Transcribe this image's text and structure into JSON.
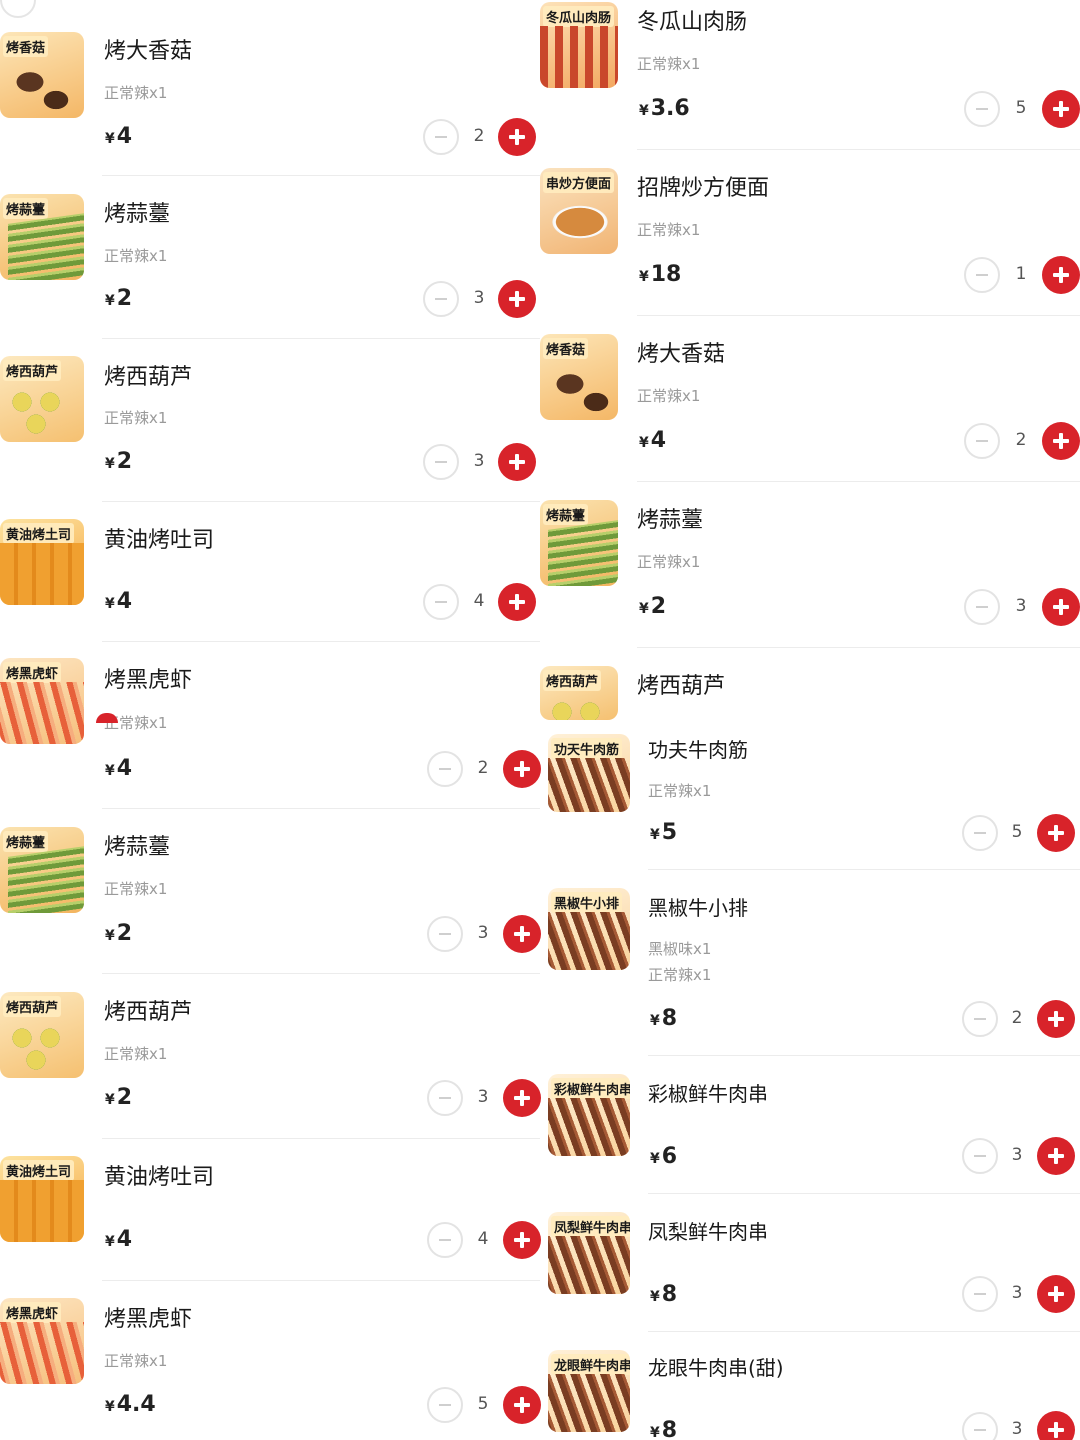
{
  "cart": {
    "left": [
      {
        "name": "烤大香菇",
        "spec": "正常辣x1",
        "price": "4",
        "qty": "2",
        "label": "烤香菇",
        "img": "mushroom"
      },
      {
        "name": "烤蒜薹",
        "spec": "正常辣x1",
        "price": "2",
        "qty": "3",
        "label": "烤蒜薹",
        "img": "garlic"
      },
      {
        "name": "烤西葫芦",
        "spec": "正常辣x1",
        "price": "2",
        "qty": "3",
        "label": "烤西葫芦",
        "img": "zucchini"
      },
      {
        "name": "黄油烤吐司",
        "spec": "",
        "price": "4",
        "qty": "4",
        "label": "黄油烤土司",
        "img": "toast"
      },
      {
        "name": "烤黑虎虾",
        "spec": "正常辣x1",
        "price": "4",
        "qty": "2",
        "label": "烤黑虎虾",
        "img": "shrimp"
      },
      {
        "name": "烤蒜薹",
        "spec": "正常辣x1",
        "price": "2",
        "qty": "3",
        "label": "烤蒜薹",
        "img": "garlic"
      },
      {
        "name": "烤西葫芦",
        "spec": "正常辣x1",
        "price": "2",
        "qty": "3",
        "label": "烤西葫芦",
        "img": "zucchini"
      },
      {
        "name": "黄油烤吐司",
        "spec": "",
        "price": "4",
        "qty": "4",
        "label": "黄油烤土司",
        "img": "toast"
      },
      {
        "name": "烤黑虎虾",
        "spec": "正常辣x1",
        "price": "4.4",
        "qty": "5",
        "label": "烤黑虎虾",
        "img": "shrimp"
      }
    ],
    "right": [
      {
        "name": "冬瓜山肉肠",
        "spec": "正常辣x1",
        "price": "3.6",
        "qty": "5",
        "label": "冬瓜山肉肠",
        "img": "sausage"
      },
      {
        "name": "招牌炒方便面",
        "spec": "正常辣x1",
        "price": "18",
        "qty": "1",
        "label": "串炒方便面",
        "img": "noodle"
      },
      {
        "name": "烤大香菇",
        "spec": "正常辣x1",
        "price": "4",
        "qty": "2",
        "label": "烤香菇",
        "img": "mushroom"
      },
      {
        "name": "烤蒜薹",
        "spec": "正常辣x1",
        "price": "2",
        "qty": "3",
        "label": "烤蒜薹",
        "img": "garlic"
      },
      {
        "name": "烤西葫芦",
        "spec": "",
        "price": "",
        "qty": "",
        "label": "烤西葫芦",
        "img": "zucchini"
      },
      {
        "name": "功夫牛肉筋",
        "spec": "正常辣x1",
        "price": "5",
        "qty": "5",
        "label": "功天牛肉筋",
        "img": "skewer"
      },
      {
        "name": "黑椒牛小排",
        "spec": "黑椒味x1",
        "spec2": "正常辣x1",
        "price": "8",
        "qty": "2",
        "label": "黑椒牛小排",
        "img": "skewer"
      },
      {
        "name": "彩椒鲜牛肉串",
        "spec": "",
        "price": "6",
        "qty": "3",
        "label": "彩椒鲜牛肉串",
        "img": "skewer"
      },
      {
        "name": "凤梨鲜牛肉串",
        "spec": "",
        "price": "8",
        "qty": "3",
        "label": "凤梨鲜牛肉串",
        "img": "skewer"
      },
      {
        "name": "龙眼牛肉串(甜)",
        "spec": "",
        "price": "8",
        "qty": "3",
        "label": "龙眼鲜牛肉串",
        "img": "skewer"
      }
    ]
  },
  "currency_symbol": "¥",
  "colors": {
    "accent": "#d8232a",
    "thumb_bg": "#f7c98a"
  }
}
